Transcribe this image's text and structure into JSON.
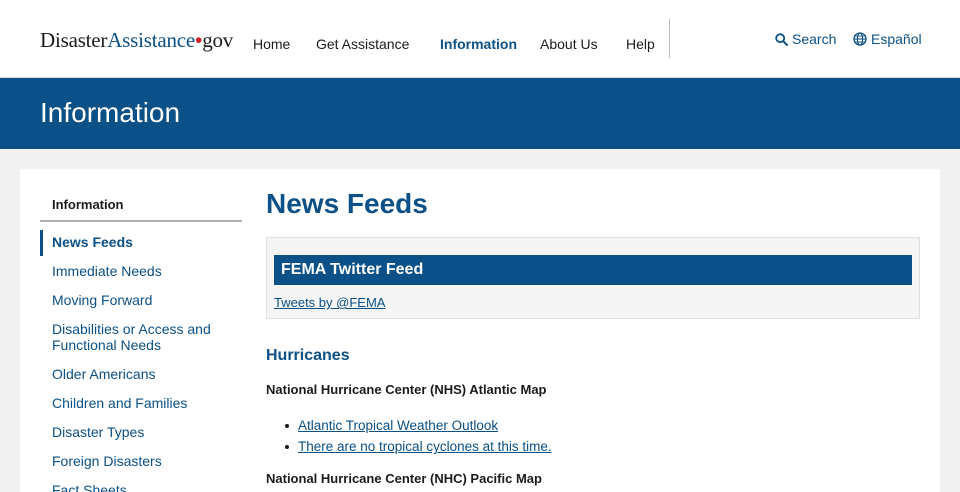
{
  "logo": {
    "part1": "Disaster",
    "part2": "Assistance",
    "dot": "•",
    "part3": "gov"
  },
  "nav": {
    "home": "Home",
    "get_assistance": "Get Assistance",
    "information": "Information",
    "about_us": "About Us",
    "help": "Help"
  },
  "utility": {
    "search": "Search",
    "espanol": "Español"
  },
  "banner": {
    "title": "Information"
  },
  "sidebar": {
    "heading": "Information",
    "items": [
      {
        "label": "News Feeds"
      },
      {
        "label": "Immediate Needs"
      },
      {
        "label": "Moving Forward"
      },
      {
        "label": "Disabilities or Access and Functional Needs"
      },
      {
        "label": "Older Americans"
      },
      {
        "label": "Children and Families"
      },
      {
        "label": "Disaster Types"
      },
      {
        "label": "Foreign Disasters"
      },
      {
        "label": "Fact Sheets"
      }
    ]
  },
  "main": {
    "title": "News Feeds",
    "twitter": {
      "heading": "FEMA Twitter Feed",
      "link": "Tweets by @FEMA"
    },
    "hurricanes": {
      "heading": "Hurricanes",
      "atlantic_heading": "National Hurricane Center (NHS) Atlantic Map",
      "atlantic_links": [
        "Atlantic Tropical Weather Outlook",
        "There are no tropical cyclones at this time."
      ],
      "pacific_heading": "National Hurricane Center (NHC) Pacific Map"
    }
  },
  "colors": {
    "brand_blue": "#0b5086",
    "logo_red": "#d12027",
    "page_bg": "#f1f1f1"
  }
}
